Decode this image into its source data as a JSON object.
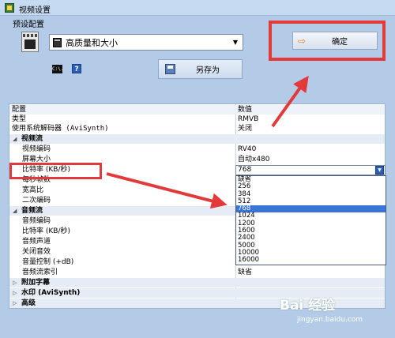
{
  "window": {
    "title": "视频设置"
  },
  "preset": {
    "label": "预设配置",
    "value": "高质量和大小"
  },
  "buttons": {
    "save_as": "另存为",
    "ok": "确定"
  },
  "toolbar": {
    "cmd_icon_text": "C:\\.",
    "help_icon_text": "?"
  },
  "grid": {
    "header": {
      "name": "配置",
      "value": "数值"
    },
    "rows": [
      {
        "name": "类型",
        "value": "RMVB"
      },
      {
        "name": "使用系统解码器 (AviSynth)",
        "value": "关闭"
      },
      {
        "name": "视频流"
      },
      {
        "name": "视频编码",
        "value": "RV40"
      },
      {
        "name": "屏幕大小",
        "value": "自动x480"
      },
      {
        "name": "比特率 (KB/秒)",
        "value": "768"
      },
      {
        "name": "每秒帧数"
      },
      {
        "name": "宽高比"
      },
      {
        "name": "二次编码"
      },
      {
        "name": "音频流"
      },
      {
        "name": "音频编码"
      },
      {
        "name": "比特率 (KB/秒)"
      },
      {
        "name": "音频声道"
      },
      {
        "name": "关闭音效"
      },
      {
        "name": "音量控制 (+dB)"
      },
      {
        "name": "音频流索引",
        "value": "缺省"
      },
      {
        "name": "附加字幕"
      },
      {
        "name": "水印 (AviSynth)"
      },
      {
        "name": "高级"
      }
    ]
  },
  "bitrate_dropdown": {
    "selected": "768",
    "options": [
      "缺省",
      "256",
      "384",
      "512",
      "768",
      "1024",
      "1200",
      "1600",
      "2400",
      "5000",
      "10000",
      "16000"
    ]
  },
  "watermark": {
    "logo": "Bai 经验",
    "url": "jingyan.baidu.com"
  },
  "colors": {
    "annotation_red": "#e23a3a",
    "selection_blue": "#3b76d6"
  }
}
